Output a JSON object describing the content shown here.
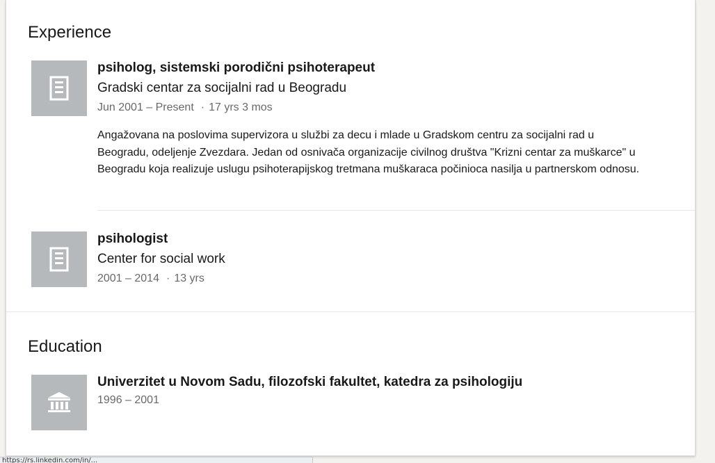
{
  "experience": {
    "title": "Experience",
    "items": [
      {
        "logo_icon": "building-icon",
        "role": "psiholog, sistemski porodični psihoterapeut",
        "company": "Gradski centar za socijalni rad u Beogradu",
        "date_range": "Jun 2001 – Present",
        "duration": "17 yrs 3 mos",
        "description": "Angažovana na poslovima supervizora u službi za decu i mlade u Gradskom centru za socijalni rad u Beogradu, odeljenje Zvezdara. Jedan od osnivača organizacije civilnog društva \"Krizni centar za muškarce\" u Beogradu koja realizuje uslugu psihoterapijskog tretmana muškaraca počinioca nasilja u partnerskom odnosu."
      },
      {
        "logo_icon": "building-icon",
        "role": "psihologist",
        "company": "Center for social work",
        "date_range": "2001 – 2014",
        "duration": "13 yrs"
      }
    ]
  },
  "education": {
    "title": "Education",
    "items": [
      {
        "logo_icon": "school-icon",
        "school": "Univerzitet u Novom Sadu, filozofski fakultet, katedra za psihologiju",
        "date_range": "1996 – 2001"
      }
    ]
  },
  "status_bar": {
    "text": "https://rs.linkedin.com/in/..."
  },
  "colors": {
    "logo_placeholder": "#b6b9bb",
    "page_background": "#f3f2ef"
  }
}
